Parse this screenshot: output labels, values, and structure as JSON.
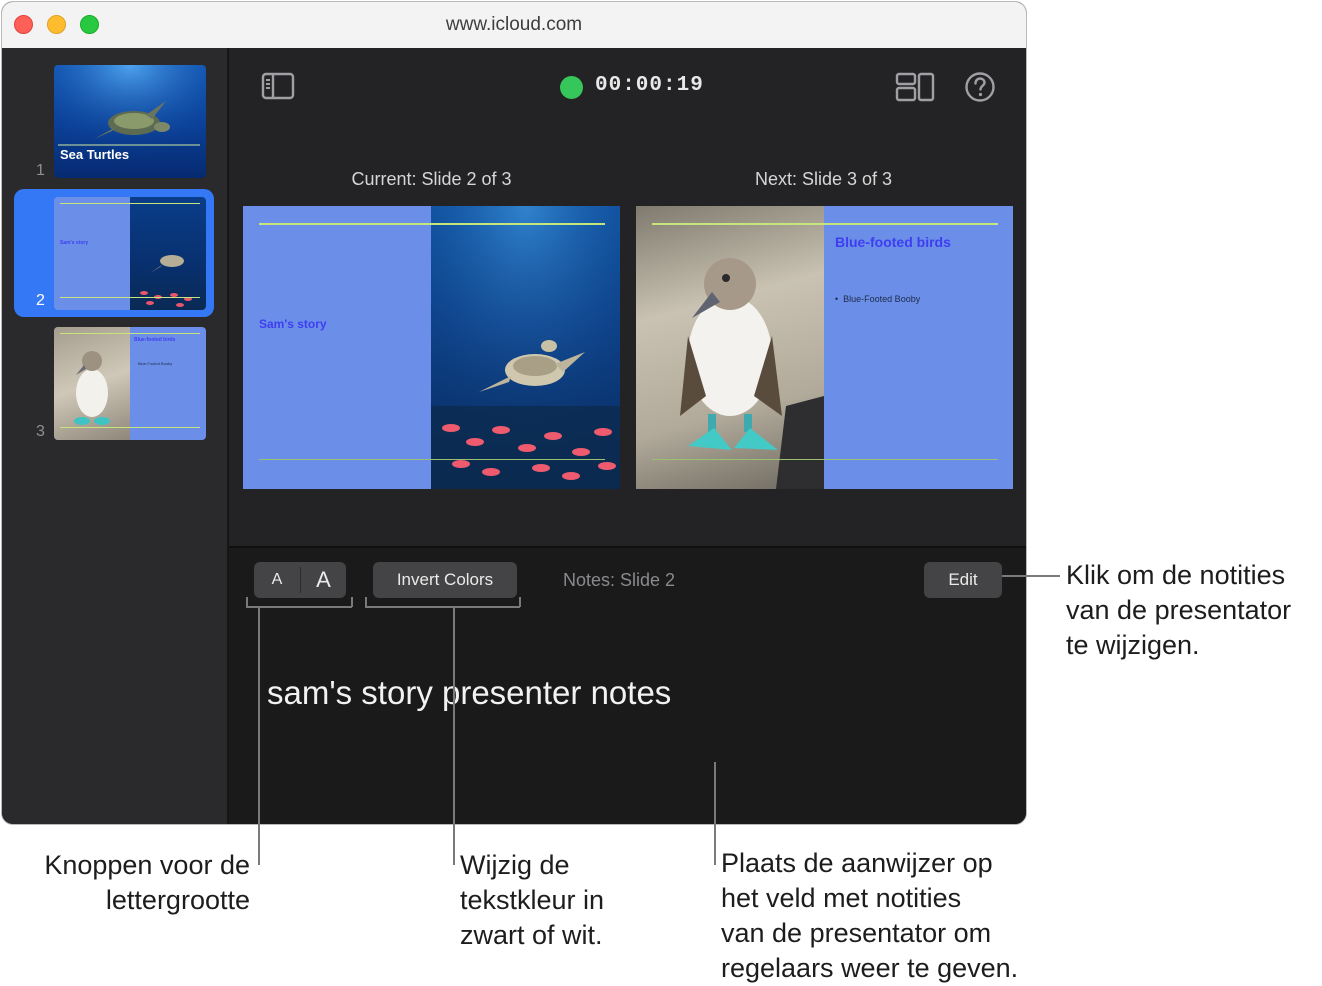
{
  "window": {
    "url": "www.icloud.com"
  },
  "sidebar": {
    "slides": [
      {
        "number": "1",
        "title": "Sea Turtles"
      },
      {
        "number": "2",
        "title": "Sam's story"
      },
      {
        "number": "3",
        "title": "Blue-footed birds",
        "bullet": "Blue-Footed Booby"
      }
    ]
  },
  "toolbar": {
    "timer": "00:00:19",
    "icons": [
      "sidebar-toggle-icon",
      "layout-icon",
      "help-icon"
    ]
  },
  "current": {
    "label": "Current: Slide 2 of 3",
    "title": "Sam's story"
  },
  "next": {
    "label": "Next: Slide 3 of 3",
    "title": "Blue-footed birds",
    "bullet": "Blue-Footed Booby"
  },
  "notes": {
    "font_small": "A",
    "font_large": "A",
    "invert_label": "Invert Colors",
    "label": "Notes: Slide 2",
    "edit_label": "Edit",
    "text": "sam's story presenter notes"
  },
  "callouts": {
    "edit": [
      "Klik om de notities",
      "van de presentator",
      "te wijzigen."
    ],
    "font": [
      "Knoppen voor de",
      "lettergrootte"
    ],
    "invert": [
      "Wijzig de",
      "tekstkleur in",
      "zwart of wit."
    ],
    "notes": [
      "Plaats de aanwijzer op",
      "het veld met notities",
      "van de presentator om",
      "regelaars weer te geven."
    ]
  },
  "colors": {
    "accent": "#3478f6",
    "slide_bg": "#6b8fe8",
    "slide_title": "#3e3ef0",
    "timer_dot": "#35c759"
  }
}
